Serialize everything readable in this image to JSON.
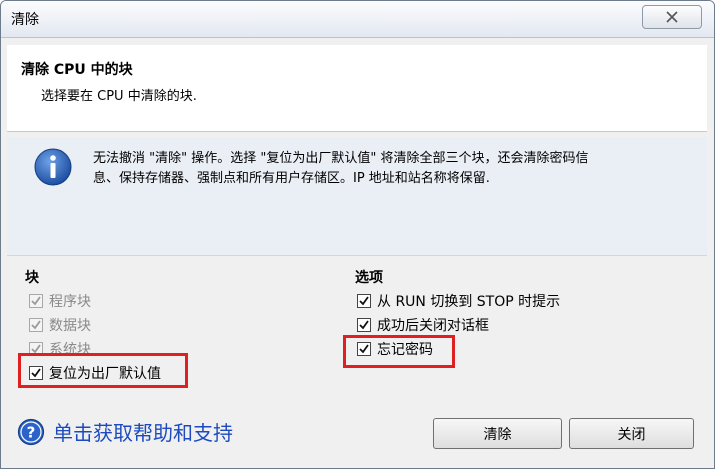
{
  "window": {
    "title": "清除"
  },
  "header": {
    "title": "清除 CPU 中的块",
    "subtitle": "选择要在 CPU 中清除的块."
  },
  "info": {
    "icon": "info-icon",
    "line1": "无法撤消 \"清除\" 操作。选择 \"复位为出厂默认值\" 将清除全部三个块，还会清除密码信",
    "line2": "息、保持存储器、强制点和所有用户存储区。IP 地址和站名称将保留."
  },
  "blocks": {
    "heading": "块",
    "items": [
      {
        "label": "程序块",
        "checked": true,
        "enabled": false
      },
      {
        "label": "数据块",
        "checked": true,
        "enabled": false
      },
      {
        "label": "系统块",
        "checked": true,
        "enabled": false
      },
      {
        "label": "复位为出厂默认值",
        "checked": true,
        "enabled": true
      }
    ]
  },
  "options": {
    "heading": "选项",
    "items": [
      {
        "label": "从 RUN 切换到 STOP 时提示",
        "checked": true
      },
      {
        "label": "成功后关闭对话框",
        "checked": true
      },
      {
        "label": "忘记密码",
        "checked": true
      }
    ]
  },
  "help": {
    "label": "单击获取帮助和支持"
  },
  "buttons": {
    "clear": "清除",
    "close": "关闭"
  },
  "colors": {
    "highlight": "#e02020",
    "link": "#1d4bbf",
    "info_bg": "#eaeef5"
  }
}
